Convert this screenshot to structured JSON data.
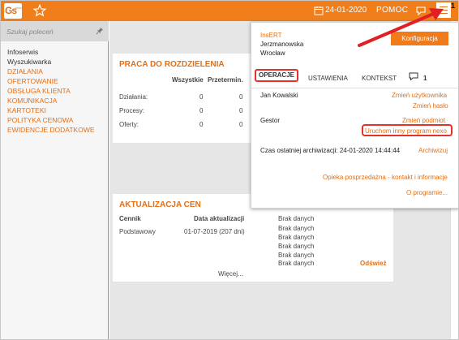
{
  "app": {
    "logo_text": "Gs",
    "logo_sub": "nexo",
    "date": "24-01-2020",
    "help": "POMOC",
    "menu_badge": "1"
  },
  "sidebar": {
    "search_placeholder": "Szukaj poleceń",
    "items": [
      {
        "label": "Infoserwis",
        "style": "dark"
      },
      {
        "label": "Wyszukiwarka",
        "style": "dark"
      },
      {
        "label": "DZIAŁANIA",
        "style": "orange"
      },
      {
        "label": "OFERTOWANIE",
        "style": "orange"
      },
      {
        "label": "OBSŁUGA KLIENTA",
        "style": "orange"
      },
      {
        "label": "KOMUNIKACJA",
        "style": "orange"
      },
      {
        "label": "KARTOTEKI",
        "style": "orange"
      },
      {
        "label": "POLITYKA CENOWA",
        "style": "orange"
      },
      {
        "label": "EWIDENCJE DODATKOWE",
        "style": "orange"
      }
    ]
  },
  "card_distribution": {
    "title": "PRACA DO ROZDZIELENIA",
    "columns": [
      "Wszystkie",
      "Przetermin."
    ],
    "rows": [
      {
        "label": "Działania:",
        "all": "0",
        "overdue": "0"
      },
      {
        "label": "Procesy:",
        "all": "0",
        "overdue": "0"
      },
      {
        "label": "Oferty:",
        "all": "0",
        "overdue": "0"
      }
    ]
  },
  "card_prices": {
    "title": "AKTUALIZACJA CEN",
    "columns": [
      "Cennik",
      "Data aktualizacji"
    ],
    "rows": [
      {
        "name": "Podstawowy",
        "date": "01-07-2019 (207 dni)"
      }
    ],
    "no_data": [
      "Brak danych",
      "Brak danych",
      "Brak danych",
      "Brak danych",
      "Brak danych",
      "Brak danych"
    ],
    "more": "Więcej...",
    "refresh": "Odśwież"
  },
  "panel": {
    "company": "InsERT",
    "street": "Jerzmanowska",
    "city": "Wrocław",
    "config_button": "Konfiguracja",
    "tabs": [
      "OPERACJE",
      "USTAWIENIA",
      "KONTEKST"
    ],
    "chat_count": "1",
    "user": "Jan Kowalski",
    "change_user": "Zmień użytkownika",
    "change_password": "Zmień hasło",
    "entity": "Gestor",
    "change_entity": "Zmień podmiot",
    "run_other": "Uruchom inny program nexo",
    "archive_label": "Czas ostatniej archiwizacji: 24-01-2020 14:44:44",
    "archive_link": "Archiwizuj",
    "aftersales": "Opieka posprzedażna - kontakt i informacje",
    "about": "O programie..."
  },
  "colors": {
    "accent": "#f07f1b",
    "highlight": "#e4312b"
  }
}
